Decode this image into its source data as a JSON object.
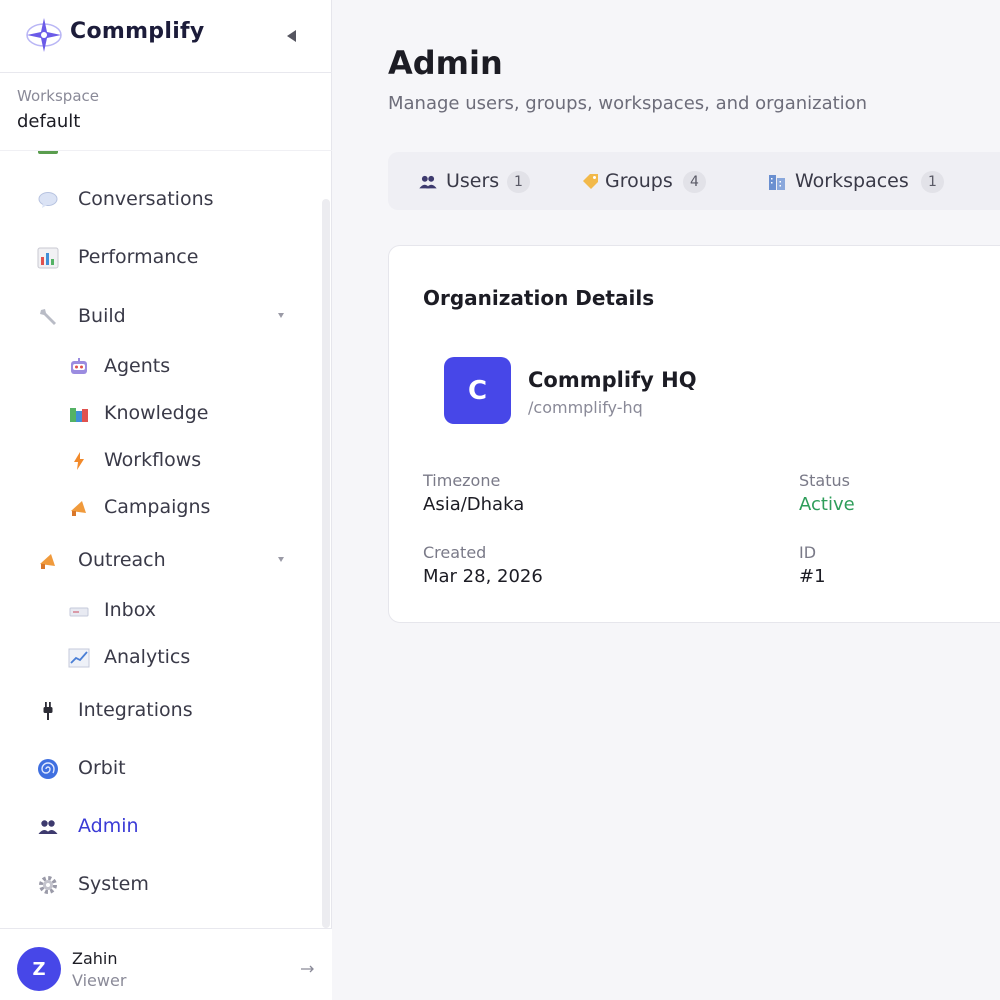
{
  "brand": {
    "name": "Commplify"
  },
  "workspace": {
    "label": "Workspace",
    "value": "default"
  },
  "nav": {
    "conversations": "Conversations",
    "performance": "Performance",
    "build": "Build",
    "agents": "Agents",
    "knowledge": "Knowledge",
    "workflows": "Workflows",
    "campaigns": "Campaigns",
    "outreach": "Outreach",
    "inbox": "Inbox",
    "analytics": "Analytics",
    "integrations": "Integrations",
    "orbit": "Orbit",
    "admin": "Admin",
    "system": "System",
    "active_item": "admin"
  },
  "user": {
    "initial": "Z",
    "name": "Zahin",
    "role": "Viewer"
  },
  "page": {
    "title": "Admin",
    "subtitle": "Manage users, groups, workspaces, and organization"
  },
  "tabs": [
    {
      "label": "Users",
      "count": "1",
      "icon": "users-icon"
    },
    {
      "label": "Groups",
      "count": "4",
      "icon": "tag-icon"
    },
    {
      "label": "Workspaces",
      "count": "1",
      "icon": "building-icon"
    }
  ],
  "org": {
    "card_title": "Organization Details",
    "logo_initial": "C",
    "name": "Commplify HQ",
    "slug": "/commplify-hq",
    "fields": {
      "timezone_label": "Timezone",
      "timezone_value": "Asia/Dhaka",
      "status_label": "Status",
      "status_value": "Active",
      "created_label": "Created",
      "created_value": "Mar 28, 2026",
      "id_label": "ID",
      "id_value": "#1"
    }
  },
  "colors": {
    "accent": "#4747e8",
    "active_nav": "#3b3bd6",
    "status_active": "#2e9d5a"
  }
}
